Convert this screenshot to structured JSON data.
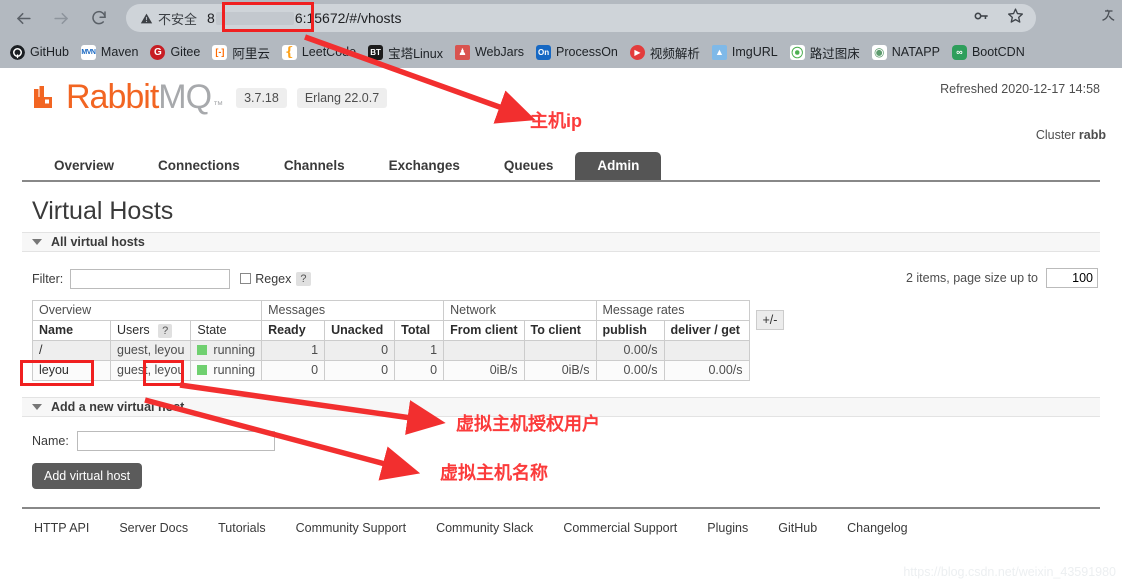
{
  "browser": {
    "nav": {
      "back": "back-arrow",
      "forward": "forward-arrow",
      "reload": "reload",
      "home": "home"
    },
    "omnibox": {
      "security_label": "不安全",
      "url_prefix": "8",
      "url_suffix": "6:15672/#/vhosts",
      "redacted": true
    },
    "omni_actions": [
      "key-icon",
      "star-icon"
    ],
    "extension": "translate-icon",
    "bookmarks": [
      {
        "label": "GitHub",
        "icon": "github-icon",
        "color": "#1b1f23",
        "glyph": ""
      },
      {
        "label": "Maven",
        "icon": "maven-icon",
        "color": "#1565c0",
        "glyph": "MVN"
      },
      {
        "label": "Gitee",
        "icon": "gitee-icon",
        "color": "#c71d23",
        "glyph": "G"
      },
      {
        "label": "阿里云",
        "icon": "aliyun-icon",
        "color": "#ff6a00",
        "glyph": "[-]"
      },
      {
        "label": "LeetCode",
        "icon": "leetcode-icon",
        "color": "#ffa116",
        "glyph": ""
      },
      {
        "label": "宝塔Linux",
        "icon": "baota-icon",
        "color": "#1b1b1b",
        "glyph": "BT"
      },
      {
        "label": "WebJars",
        "icon": "webjars-icon",
        "color": "#d9534f",
        "glyph": ""
      },
      {
        "label": "ProcessOn",
        "icon": "processon-icon",
        "color": "#1668c3",
        "glyph": "On"
      },
      {
        "label": "视频解析",
        "icon": "video-parse-icon",
        "color": "#e33c3c",
        "glyph": ""
      },
      {
        "label": "ImgURL",
        "icon": "imgurl-icon",
        "color": "#7fb9e8",
        "glyph": ""
      },
      {
        "label": "路过图床",
        "icon": "tuchuang-icon",
        "color": "#4caf50",
        "glyph": ""
      },
      {
        "label": "NATAPP",
        "icon": "natapp-icon",
        "color": "#5d9c6e",
        "glyph": ""
      },
      {
        "label": "BootCDN",
        "icon": "bootcdn-icon",
        "color": "#2e9e5b",
        "glyph": ""
      }
    ]
  },
  "app": {
    "brand_rabbit": "Rabbit",
    "brand_mq": "MQ",
    "brand_tm": "™",
    "version": "3.7.18",
    "erlang": "Erlang 22.0.7",
    "refreshed": "Refreshed 2020-12-17 14:58",
    "cluster_label": "Cluster",
    "cluster_name": "rabb",
    "tabs": [
      {
        "label": "Overview",
        "active": false
      },
      {
        "label": "Connections",
        "active": false
      },
      {
        "label": "Channels",
        "active": false
      },
      {
        "label": "Exchanges",
        "active": false
      },
      {
        "label": "Queues",
        "active": false
      },
      {
        "label": "Admin",
        "active": true
      }
    ],
    "page_title": "Virtual Hosts",
    "all_vhosts_section": "All virtual hosts",
    "filter_label": "Filter:",
    "filter_value": "",
    "regex_label": "Regex",
    "help_marker": "?",
    "pager_text": "2 items, page size up to",
    "page_size": "100",
    "plus_minus": "+/-",
    "group_headers": {
      "overview": "Overview",
      "messages": "Messages",
      "network": "Network",
      "message_rates": "Message rates"
    },
    "columns": [
      "Name",
      "Users",
      "?",
      "State",
      "Ready",
      "Unacked",
      "Total",
      "From client",
      "To client",
      "publish",
      "deliver / get"
    ],
    "rows": [
      {
        "name": "/",
        "users": "guest, leyou",
        "state": "running",
        "ready": "1",
        "unacked": "0",
        "total": "1",
        "from_client": "",
        "to_client": "",
        "publish": "0.00/s",
        "deliver_get": ""
      },
      {
        "name": "leyou",
        "users": "guest, leyou",
        "state": "running",
        "ready": "0",
        "unacked": "0",
        "total": "0",
        "from_client": "0iB/s",
        "to_client": "0iB/s",
        "publish": "0.00/s",
        "deliver_get": "0.00/s"
      }
    ],
    "add_section": "Add a new virtual host",
    "add_name_label": "Name:",
    "add_name_value": "",
    "add_button": "Add virtual host",
    "footer_links": [
      "HTTP API",
      "Server Docs",
      "Tutorials",
      "Community Support",
      "Community Slack",
      "Commercial Support",
      "Plugins",
      "GitHub",
      "Changelog"
    ]
  },
  "annotations": {
    "host_ip": "主机ip",
    "vhost_users": "虚拟主机授权用户",
    "vhost_name": "虚拟主机名称",
    "color": "#fb3b3b"
  },
  "watermark": "https://blog.csdn.net/weixin_43591980"
}
